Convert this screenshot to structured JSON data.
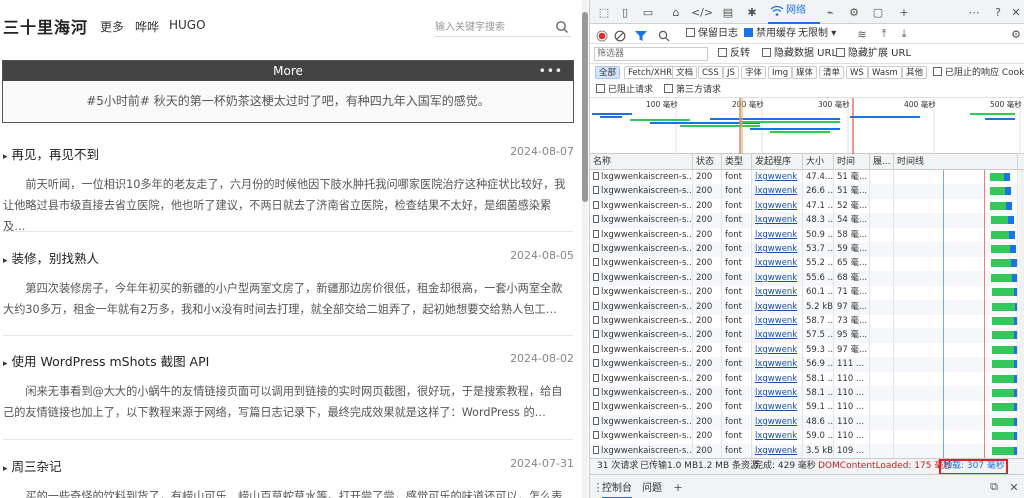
{
  "blog": {
    "site_title": "三十里海河",
    "nav": [
      "更多",
      "哗哗",
      "HUGO"
    ],
    "search_placeholder": "输入关键字搜索",
    "more_card": {
      "header": "More",
      "dots": "•••",
      "content": "#5小时前# 秋天的第一杯奶茶这梗太过时了吧，有种四九年入国军的感觉。"
    },
    "posts": [
      {
        "title": "再见，再见不到",
        "date": "2024-08-07",
        "excerpt": "前天听闻，一位相识10多年的老友走了，六月份的时候他因下肢水肿托我问哪家医院治疗这种症状比较好，我让他略过县市级直接去省立医院，他也听了建议，不两日就去了济南省立医院，检查结果不太好，是细菌感染累及…"
      },
      {
        "title": "装修，别找熟人",
        "date": "2024-08-05",
        "excerpt": "第四次装修房子，今年年初买的新疆的小户型两室文房了，新疆那边房价很低，租金却很高，一套小两室全款大约30多万，租金一年就有2万多，我和小x没有时间去打理，就全部交给二姐弄了，起初她想要交给熟人包工…"
      },
      {
        "title": "使用 WordPress mShots 截图 API",
        "date": "2024-08-02",
        "excerpt": "闲来无事看到@大大的小蜗牛的友情链接页面可以调用到链接的实时网页截图，很好玩，于是搜索教程，给自己的友情链接也加上了，以下教程来源于网络，写篇日志记录下，最终完成效果就是这样了：WordPress 的…"
      },
      {
        "title": "周三杂记",
        "date": "2024-07-31",
        "excerpt": "买的一些奇怪的饮料到货了，有崂山可乐、崂山百草蛇草水等。打开尝了尝，感觉可乐的味道还可以，怎么表达味"
      }
    ]
  },
  "devtools": {
    "network_tab": "网络",
    "controls": {
      "preserve_log": "保留日志",
      "disable_cache": "禁用缓存",
      "throttle": "无限制"
    },
    "filter": {
      "placeholder": "筛选器",
      "invert": "反转",
      "hide_data_url": "隐藏数据 URL",
      "hide_ext_url": "隐藏扩展 URL"
    },
    "types": [
      "全部",
      "Fetch/XHR",
      "文档",
      "CSS",
      "JS",
      "字体",
      "Img",
      "媒体",
      "清单",
      "WS",
      "Wasm",
      "其他"
    ],
    "blocked_cookies": "已阻止的响应 Cookie",
    "blocked_requests": "已阻止请求",
    "third_party": "第三方请求",
    "timeline_ticks": [
      "100 毫秒",
      "200 毫秒",
      "300 毫秒",
      "400 毫秒",
      "500 毫秒"
    ],
    "columns": [
      "名称",
      "状态",
      "类型",
      "发起程序",
      "大小",
      "时间",
      "履...",
      "时间线"
    ],
    "rows": [
      {
        "name": "lxgwwenkaiscreen-s...",
        "status": "200",
        "type": "font",
        "initiator": "lxgwwenk",
        "size": "47.4...",
        "time": "51 毫..."
      },
      {
        "name": "lxgwwenkaiscreen-s...",
        "status": "200",
        "type": "font",
        "initiator": "lxgwwenk",
        "size": "26.6 ...",
        "time": "51 毫..."
      },
      {
        "name": "lxgwwenkaiscreen-s...",
        "status": "200",
        "type": "font",
        "initiator": "lxgwwenk",
        "size": "47.1 ...",
        "time": "52 毫..."
      },
      {
        "name": "lxgwwenkaiscreen-s...",
        "status": "200",
        "type": "font",
        "initiator": "lxgwwenk",
        "size": "48.3 ...",
        "time": "54 毫..."
      },
      {
        "name": "lxgwwenkaiscreen-s...",
        "status": "200",
        "type": "font",
        "initiator": "lxgwwenk",
        "size": "50.9 ...",
        "time": "58 毫..."
      },
      {
        "name": "lxgwwenkaiscreen-s...",
        "status": "200",
        "type": "font",
        "initiator": "lxgwwenk",
        "size": "53.7 ...",
        "time": "59 毫..."
      },
      {
        "name": "lxgwwenkaiscreen-s...",
        "status": "200",
        "type": "font",
        "initiator": "lxgwwenk",
        "size": "55.2 ...",
        "time": "65 毫..."
      },
      {
        "name": "lxgwwenkaiscreen-s...",
        "status": "200",
        "type": "font",
        "initiator": "lxgwwenk",
        "size": "55.6 ...",
        "time": "68 毫..."
      },
      {
        "name": "lxgwwenkaiscreen-s...",
        "status": "200",
        "type": "font",
        "initiator": "lxgwwenk",
        "size": "60.1 ...",
        "time": "71 毫..."
      },
      {
        "name": "lxgwwenkaiscreen-s...",
        "status": "200",
        "type": "font",
        "initiator": "lxgwwenk",
        "size": "5.2 kB",
        "time": "97 毫..."
      },
      {
        "name": "lxgwwenkaiscreen-s...",
        "status": "200",
        "type": "font",
        "initiator": "lxgwwenk",
        "size": "58.7 ...",
        "time": "73 毫..."
      },
      {
        "name": "lxgwwenkaiscreen-s...",
        "status": "200",
        "type": "font",
        "initiator": "lxgwwenk",
        "size": "57.5 ...",
        "time": "95 毫..."
      },
      {
        "name": "lxgwwenkaiscreen-s...",
        "status": "200",
        "type": "font",
        "initiator": "lxgwwenk",
        "size": "59.3 ...",
        "time": "97 毫..."
      },
      {
        "name": "lxgwwenkaiscreen-s...",
        "status": "200",
        "type": "font",
        "initiator": "lxgwwenk",
        "size": "56.9 ...",
        "time": "111 ..."
      },
      {
        "name": "lxgwwenkaiscreen-s...",
        "status": "200",
        "type": "font",
        "initiator": "lxgwwenk",
        "size": "58.1 ...",
        "time": "110 ..."
      },
      {
        "name": "lxgwwenkaiscreen-s...",
        "status": "200",
        "type": "font",
        "initiator": "lxgwwenk",
        "size": "58.1 ...",
        "time": "110 ..."
      },
      {
        "name": "lxgwwenkaiscreen-s...",
        "status": "200",
        "type": "font",
        "initiator": "lxgwwenk",
        "size": "59.1 ...",
        "time": "110 ..."
      },
      {
        "name": "lxgwwenkaiscreen-s...",
        "status": "200",
        "type": "font",
        "initiator": "lxgwwenk",
        "size": "48.6 ...",
        "time": "110 ..."
      },
      {
        "name": "lxgwwenkaiscreen-s...",
        "status": "200",
        "type": "font",
        "initiator": "lxgwwenk",
        "size": "59.0 ...",
        "time": "110 ..."
      },
      {
        "name": "lxgwwenkaiscreen-s...",
        "status": "200",
        "type": "font",
        "initiator": "lxgwwenk",
        "size": "3.5 kB",
        "time": "109 ..."
      }
    ],
    "status_bar": {
      "requests": "31 次请求",
      "transferred": "已传输1.0 MB",
      "resources": "1.2 MB 条资源",
      "finish": "完成: 429 毫秒",
      "dcl": "DOMContentLoaded: 175 毫秒",
      "load": "加载: 307 毫秒"
    },
    "drawer": {
      "console": "控制台",
      "issues": "问题"
    },
    "colors": {
      "accent": "#1a73e8",
      "waterfall_green": "#34c759",
      "waterfall_blue": "#1a73e8",
      "highlight_red": "#e02020"
    }
  }
}
